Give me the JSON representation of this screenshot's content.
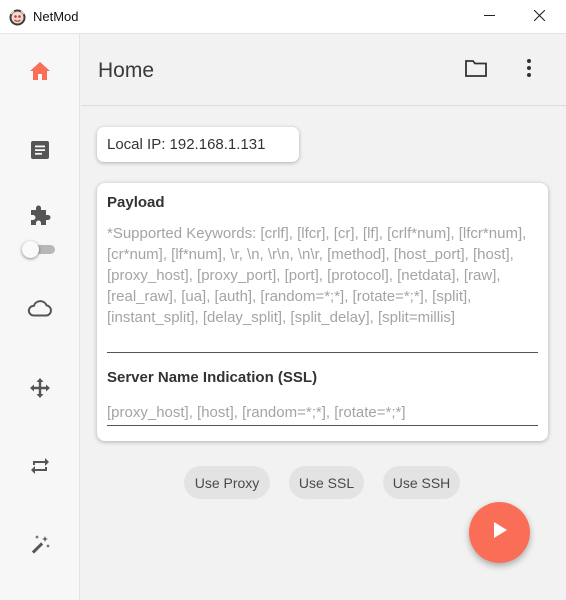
{
  "window": {
    "title": "NetMod",
    "minimize_icon": "minimize-icon",
    "close_icon": "close-icon"
  },
  "sidebar": {
    "items": [
      {
        "name": "home",
        "icon": "home-icon",
        "active": true
      },
      {
        "name": "logs",
        "icon": "document-icon"
      },
      {
        "name": "plugins",
        "icon": "puzzle-icon"
      },
      {
        "name": "cloud",
        "icon": "cloud-icon"
      },
      {
        "name": "move",
        "icon": "move-arrows-icon"
      },
      {
        "name": "repeat",
        "icon": "repeat-icon"
      },
      {
        "name": "tools",
        "icon": "magic-wand-icon"
      }
    ],
    "toggle_on": false
  },
  "header": {
    "title": "Home",
    "folder_icon": "folder-icon",
    "menu_icon": "more-vertical-icon"
  },
  "local_ip": {
    "text": "Local IP: 192.168.1.131"
  },
  "payload": {
    "label": "Payload",
    "value": "",
    "placeholder": "*Supported Keywords: [crlf], [lfcr], [cr], [lf], [crlf*num], [lfcr*num], [cr*num], [lf*num], \\r, \\n, \\r\\n, \\n\\r, [method], [host_port], [host], [proxy_host], [proxy_port], [port], [protocol], [netdata], [raw], [real_raw], [ua], [auth], [random=*;*], [rotate=*;*], [split], [instant_split], [delay_split], [split_delay], [split=millis]"
  },
  "sni": {
    "label": "Server Name Indication (SSL)",
    "value": "",
    "placeholder": "[proxy_host], [host], [random=*;*], [rotate=*;*]"
  },
  "chips": {
    "proxy": "Use Proxy",
    "ssl": "Use SSL",
    "ssh": "Use SSH"
  },
  "fab": {
    "icon": "play-icon"
  },
  "colors": {
    "accent": "#fa6e57",
    "background": "#f2f2f2",
    "card": "#ffffff",
    "chip": "#e3e3e3",
    "icon": "#555555"
  }
}
